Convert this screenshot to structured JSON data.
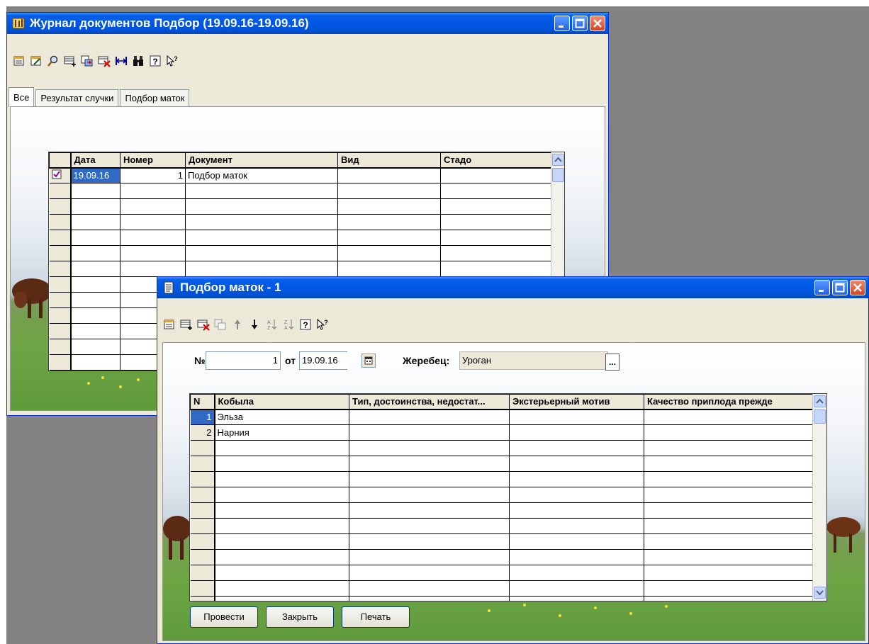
{
  "journal_window": {
    "title": "Журнал документов  Подбор (19.09.16-19.09.16)",
    "tabs": [
      "Все",
      "Результат случки",
      "Подбор маток"
    ],
    "toolbar_icons": [
      "new-document-icon",
      "edit-document-icon",
      "find-icon",
      "add-row-icon",
      "copy-icon",
      "delete-icon",
      "range-icon",
      "binoculars-icon",
      "help-icon",
      "whatis-icon"
    ],
    "table": {
      "headers": [
        "Дата",
        "Номер",
        "Документ",
        "Вид",
        "Стадо"
      ],
      "rows": [
        {
          "date": "19.09.16",
          "number": "1",
          "document": "Подбор маток",
          "kind": "",
          "herd": ""
        }
      ]
    }
  },
  "doc_window": {
    "title": "Подбор маток - 1",
    "toolbar_icons": [
      "new-document-icon",
      "add-row-icon",
      "delete-row-icon",
      "copy-row-icon",
      "arrow-up-icon",
      "arrow-down-icon",
      "sort-asc-icon",
      "sort-desc-icon",
      "help-icon",
      "whatis-icon"
    ],
    "number_label": "№",
    "number_value": "1",
    "date_label": "от",
    "date_value": "19.09.16",
    "stallion_label": "Жеребец:",
    "stallion_value": "Уроган",
    "browse_label": "...",
    "table": {
      "headers": [
        "N",
        "Кобыла",
        "Тип, достоинства, недостат...",
        "Экстерьерный мотив",
        "Качество приплода прежде"
      ],
      "rows": [
        {
          "n": "1",
          "mare": "Эльза"
        },
        {
          "n": "2",
          "mare": "Нарния"
        }
      ]
    },
    "buttons": {
      "post": "Провести",
      "close": "Закрыть",
      "print": "Печать"
    }
  },
  "colors": {
    "titlebar": "#0058e6",
    "window_bg": "#ece9d8",
    "selection": "#316ac5",
    "desktop": "#828282"
  }
}
